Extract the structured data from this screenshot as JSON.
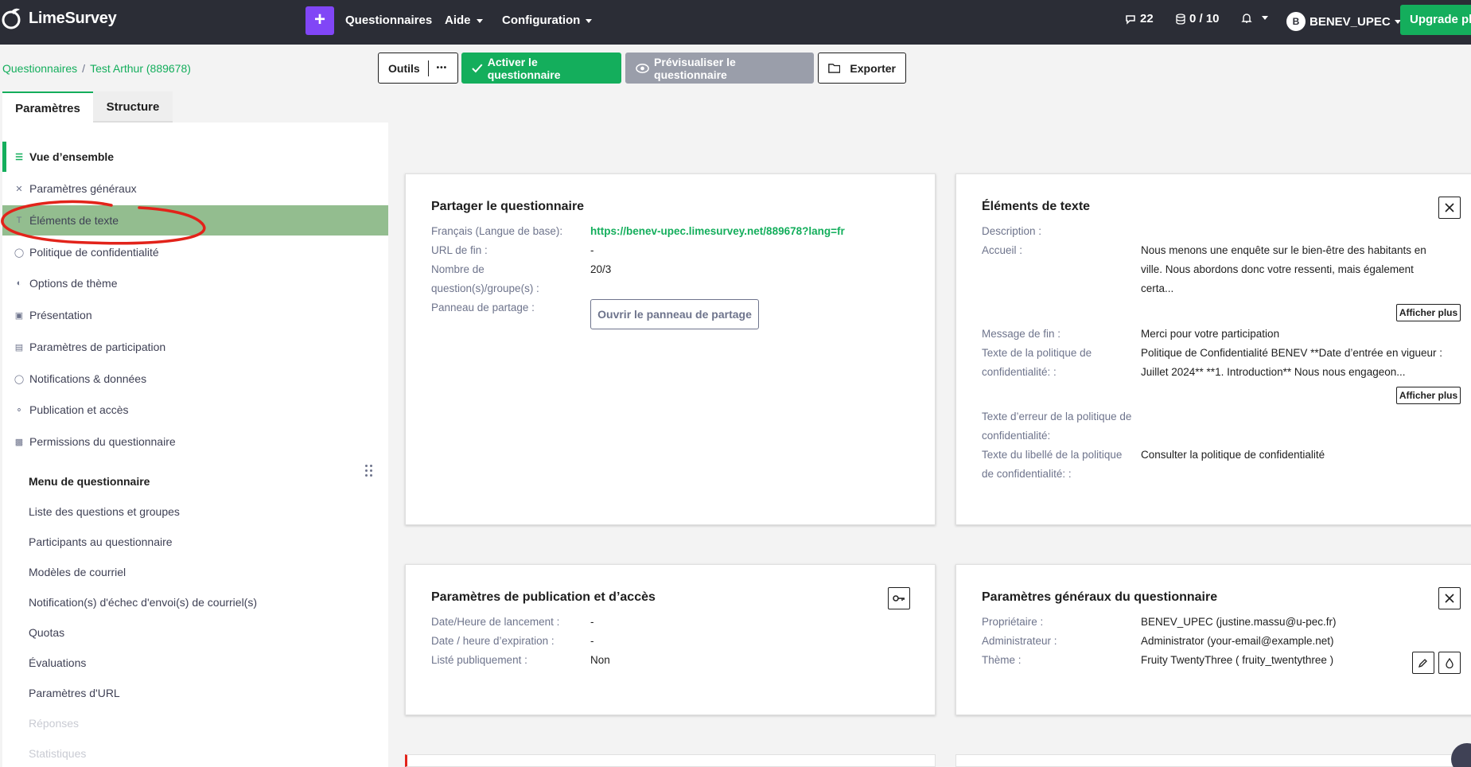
{
  "app": {
    "name": "LimeSurvey",
    "colors": {
      "navbar": "#2b2d36",
      "accent": "#14ae5c",
      "plus": "#8146f6",
      "selected": "#93bd8f"
    }
  },
  "navbar": {
    "plus_label": "+",
    "items": [
      "Questionnaires",
      "Aide",
      "Configuration"
    ],
    "chat_count": "22",
    "storage": "0 / 10",
    "user_initial": "B",
    "user_name": "BENEV_UPEC",
    "upgrade_label": "Upgrade plan"
  },
  "breadcrumb": {
    "root": "Questionnaires",
    "separator": "/",
    "current": "Test Arthur (889678)"
  },
  "toolbar": {
    "tools": "Outils",
    "more": "•••",
    "activate": "Activer le questionnaire",
    "preview": "Prévisualiser le questionnaire",
    "export": "Exporter"
  },
  "tabs": [
    "Paramètres",
    "Structure"
  ],
  "sidebar": {
    "items": [
      "Vue d’ensemble",
      "Paramètres généraux",
      "Éléments de texte",
      "Politique de confidentialité",
      "Options de thème",
      "Présentation",
      "Paramètres de participation",
      "Notifications & données",
      "Publication et accès",
      "Permissions du questionnaire"
    ],
    "menu_title": "Menu de questionnaire",
    "menu_links": [
      "Liste des questions et groupes",
      "Participants au questionnaire",
      "Modèles de courriel",
      "Notification(s) d'échec d'envoi(s) de courriel(s)",
      "Quotas",
      "Évaluations",
      "Paramètres d'URL",
      "Réponses",
      "Statistiques"
    ]
  },
  "cards": {
    "share": {
      "title": "Partager le questionnaire",
      "lang_label": "Français (Langue de base):",
      "lang_url": "https://benev-upec.limesurvey.net/889678?lang=fr",
      "endurl_label": "URL de fin :",
      "endurl_value": "-",
      "count_label_1": "Nombre de",
      "count_label_2": "question(s)/groupe(s) :",
      "count_value": "20/3",
      "panel_label": "Panneau de partage :",
      "panel_button": "Ouvrir le panneau de partage"
    },
    "text": {
      "title": "Éléments de texte",
      "desc_label": "Description :",
      "welcome_label": "Accueil :",
      "welcome_1": "Nous menons une enquête sur le bien-être des habitants en",
      "welcome_2": "ville. Nous abordons donc votre ressenti, mais également",
      "welcome_3": "certa...",
      "more": "Afficher plus",
      "end_label": "Message de fin :",
      "end_value": "Merci pour votre participation",
      "policy_label_1": "Texte de la politique de",
      "policy_label_2": "confidentialité: :",
      "policy_1": "Politique de Confidentialité BENEV **Date d’entrée en vigueur :",
      "policy_2": "Juillet 2024** **1. Introduction** Nous nous engageon...",
      "error_label_1": "Texte d’erreur de la politique de",
      "error_label_2": "confidentialité:",
      "caption_label_1": "Texte du libellé de la politique",
      "caption_label_2": "de confidentialité: :",
      "caption_value": "Consulter la politique de confidentialité"
    },
    "publication": {
      "title": "Paramètres de publication et d’accès",
      "start_label": "Date/Heure de lancement :",
      "start_value": "-",
      "expiry_label": "Date / heure d’expiration :",
      "expiry_value": "-",
      "public_label": "Listé publiquement :",
      "public_value": "Non"
    },
    "general": {
      "title": "Paramètres généraux du questionnaire",
      "owner_label": "Propriétaire :",
      "owner_value": "BENEV_UPEC (justine.massu@u-pec.fr)",
      "admin_label": "Administrateur :",
      "admin_value": "Administrator (your-email@example.net)",
      "theme_label": "Thème :",
      "theme_value": "Fruity TwentyThree ( fruity_twentythree )"
    }
  }
}
